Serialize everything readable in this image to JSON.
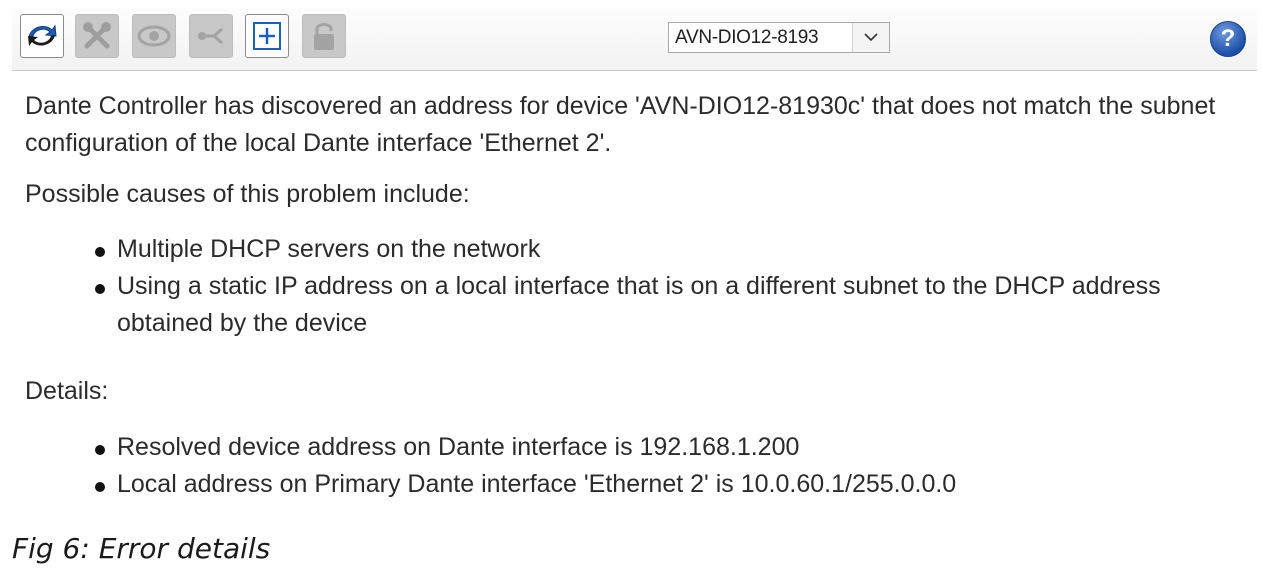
{
  "toolbar": {
    "buttons": [
      {
        "name": "refresh-icon",
        "state": "enabled"
      },
      {
        "name": "tools-icon",
        "state": "disabled"
      },
      {
        "name": "eye-icon",
        "state": "disabled"
      },
      {
        "name": "network-icon",
        "state": "disabled"
      },
      {
        "name": "expand-icon",
        "state": "enabled"
      },
      {
        "name": "lock-icon",
        "state": "disabled"
      }
    ],
    "device_select": {
      "value": "AVN-DIO12-8193"
    },
    "help_label": "?"
  },
  "message": {
    "paragraph1": "Dante Controller has discovered an address for device 'AVN-DIO12-81930c' that does not match the subnet configuration of the local Dante interface 'Ethernet 2'.",
    "causes_heading": "Possible causes of this problem include:",
    "causes": [
      "Multiple DHCP servers on the network",
      "Using a static IP address on a local interface that is on a different subnet to the DHCP address obtained by the device"
    ],
    "details_heading": "Details:",
    "details": [
      "Resolved device address on Dante interface is 192.168.1.200",
      "Local address on Primary Dante interface 'Ethernet 2' is 10.0.60.1/255.0.0.0"
    ]
  },
  "caption": "Fig 6:  Error details",
  "colors": {
    "disabled_button": "#c8c8c8",
    "help_blue": "#1d4fa8",
    "refresh_blue": "#1d5fb8"
  }
}
